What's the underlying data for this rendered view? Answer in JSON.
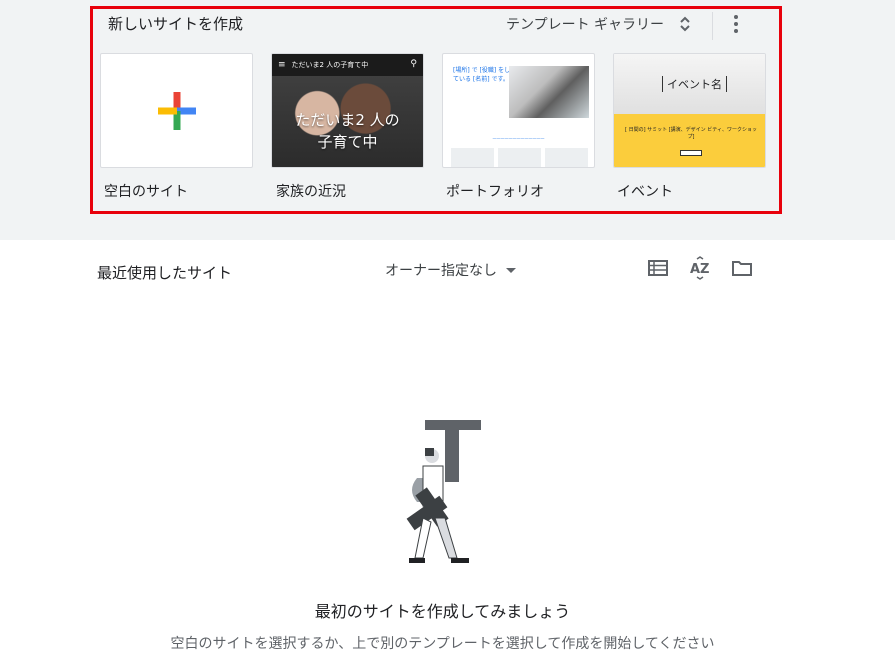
{
  "new_site": {
    "title": "新しいサイトを作成",
    "gallery_label": "テンプレート ギャラリー",
    "templates": [
      {
        "label": "空白のサイト"
      },
      {
        "label": "家族の近況",
        "bar_text": "ただいま2 人の子育て中",
        "headline_line1": "ただいま2 人の",
        "headline_line2": "子育て中"
      },
      {
        "label": "ポートフォリオ",
        "tagline": "[場所] で [役職] をしている [名前] です。"
      },
      {
        "label": "イベント",
        "event_title": "イベント名",
        "event_desc": "[ 日間の] サミット [講演、デザイン ビティ、ワークショップ]"
      }
    ]
  },
  "recent": {
    "title": "最近使用したサイト",
    "owner_filter": "オーナー指定なし"
  },
  "empty_state": {
    "title": "最初のサイトを作成してみましょう",
    "subtitle": "空白のサイトを選択するか、上で別のテンプレートを選択して作成を開始してください"
  },
  "colors": {
    "highlight": "#e8000b",
    "google_blue": "#4285f4",
    "google_red": "#ea4335",
    "google_yellow": "#fbbc04",
    "google_green": "#34a853"
  },
  "icons": [
    "plus-icon",
    "unfold-icon",
    "more-vert-icon",
    "list-view-icon",
    "sort-az-icon",
    "folder-icon",
    "search-icon",
    "menu-icon"
  ]
}
